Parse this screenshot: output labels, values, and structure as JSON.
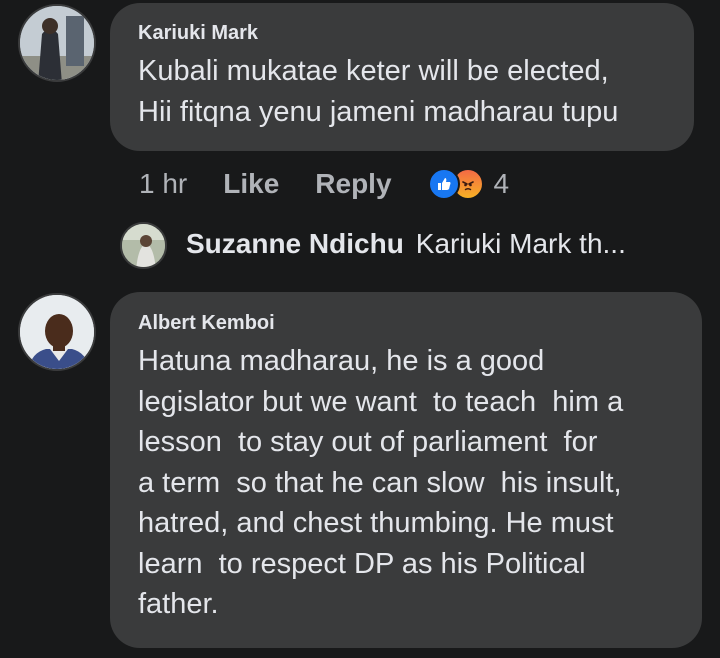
{
  "comments": [
    {
      "author": "Kariuki Mark",
      "text": "Kubali mukatae keter will be elected,\nHii fitqna yenu jameni madharau tupu",
      "time": "1 hr",
      "like_label": "Like",
      "reply_label": "Reply",
      "reaction_count": "4",
      "reactions": [
        "like-icon",
        "angry-icon"
      ]
    },
    {
      "author": "Albert Kemboi",
      "text": "Hatuna madharau, he is a good\nlegislator but we want  to teach  him a\nlesson  to stay out of parliament  for\na term  so that he can slow  his insult,\nhatred, and chest thumbing. He must\nlearn  to respect DP as his Political\nfather."
    }
  ],
  "reply_preview": {
    "author": "Suzanne Ndichu",
    "snippet": "Kariuki Mark th..."
  },
  "colors": {
    "background": "#18191a",
    "bubble": "#3a3b3c",
    "text": "#e4e6eb",
    "secondary_text": "#b0b3b8",
    "like_blue": "#1877f2"
  }
}
